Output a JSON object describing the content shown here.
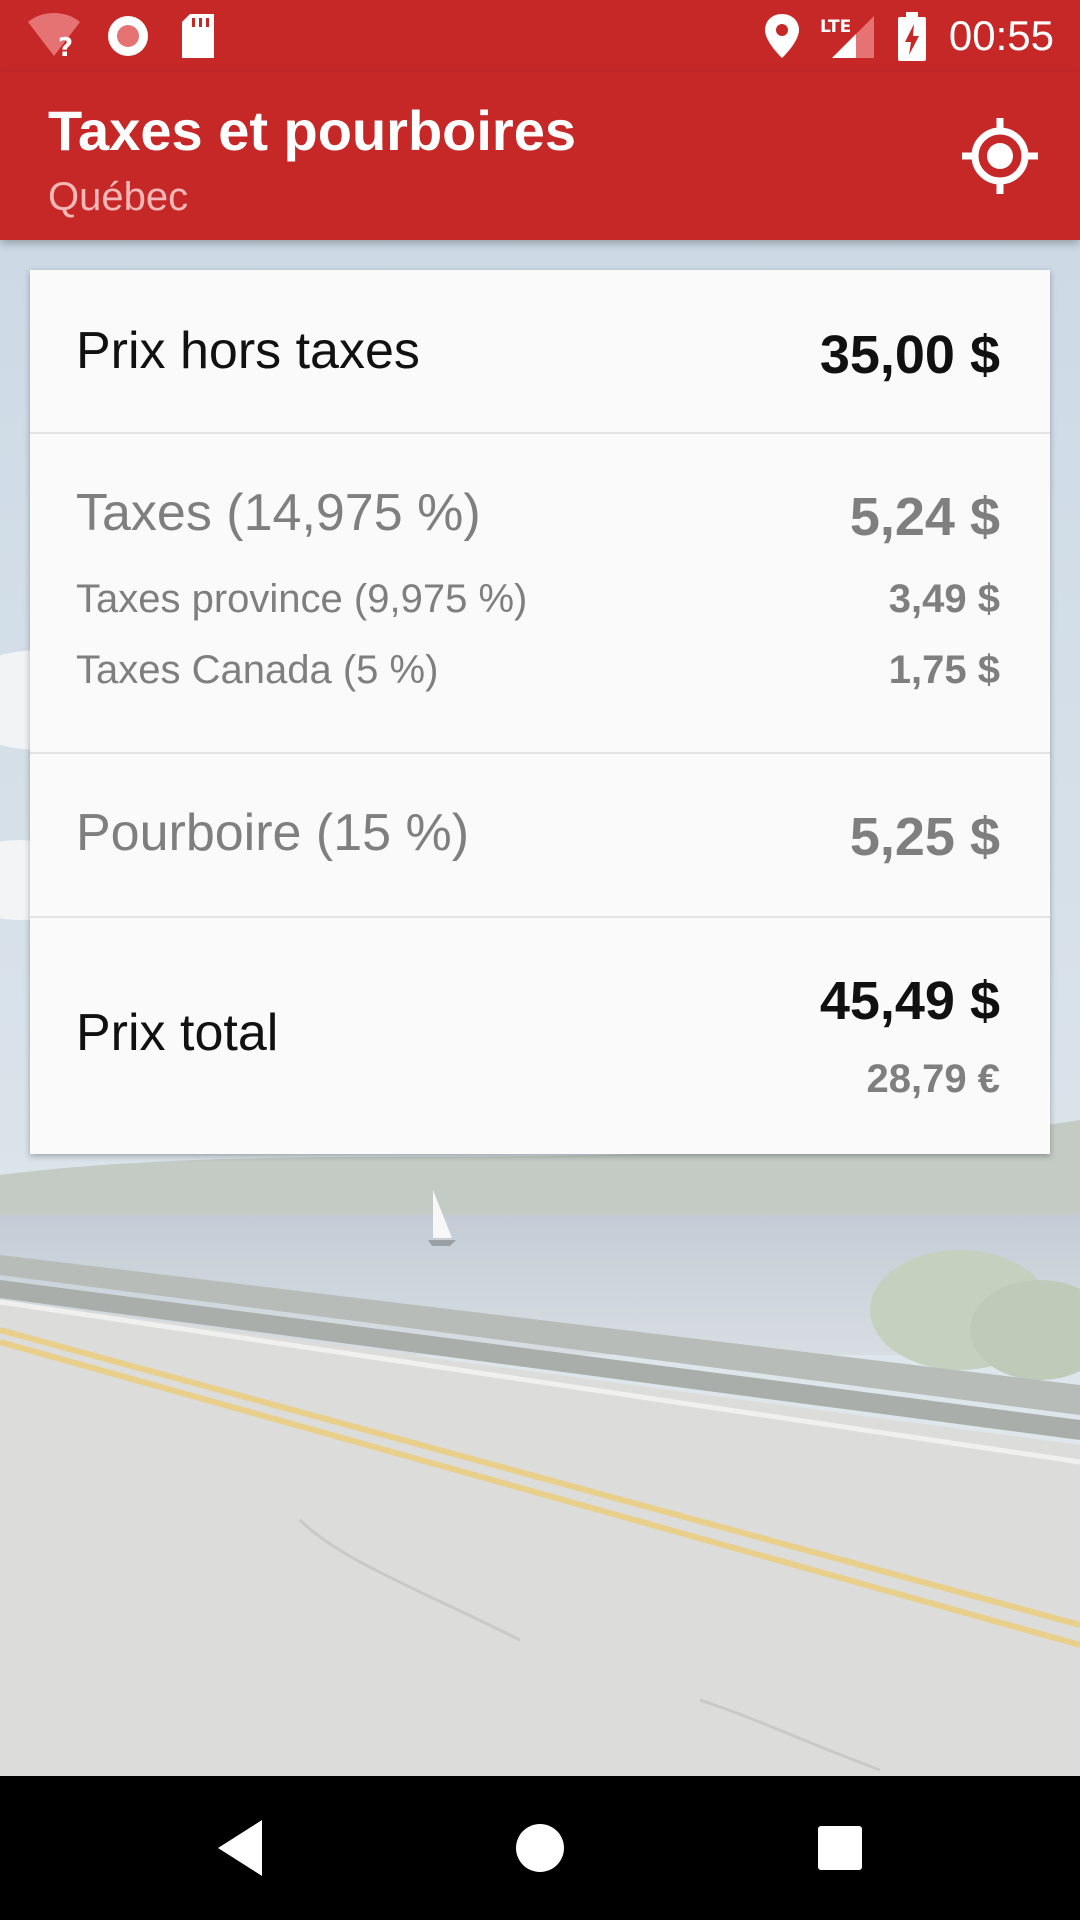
{
  "status_bar": {
    "time": "00:55",
    "icons": [
      "wifi-unknown-icon",
      "record-icon",
      "sd-card-icon",
      "location-icon",
      "lte-signal-icon",
      "battery-charging-icon"
    ],
    "network_label": "LTE"
  },
  "toolbar": {
    "title": "Taxes et pourboires",
    "subtitle": "Québec",
    "action_icon": "gps-locate-icon"
  },
  "card": {
    "price": {
      "label": "Prix hors taxes",
      "value": "35,00 $"
    },
    "taxes": {
      "label": "Taxes (14,975 %)",
      "value": "5,24 $",
      "province": {
        "label": "Taxes province (9,975 %)",
        "value": "3,49 $"
      },
      "canada": {
        "label": "Taxes Canada (5 %)",
        "value": "1,75 $"
      }
    },
    "tip": {
      "label": "Pourboire (15 %)",
      "value": "5,25 $"
    },
    "total": {
      "label": "Prix total",
      "value": "45,49 $",
      "value_eur": "28,79 €"
    }
  },
  "nav_bar": {
    "buttons": [
      "back-icon",
      "home-icon",
      "recents-icon"
    ]
  },
  "colors": {
    "primary": "#c62828",
    "subtitle": "#f5b7b7",
    "text_dark": "#111111",
    "text_gray": "#7f7f7f",
    "card_bg": "#fafafa"
  }
}
